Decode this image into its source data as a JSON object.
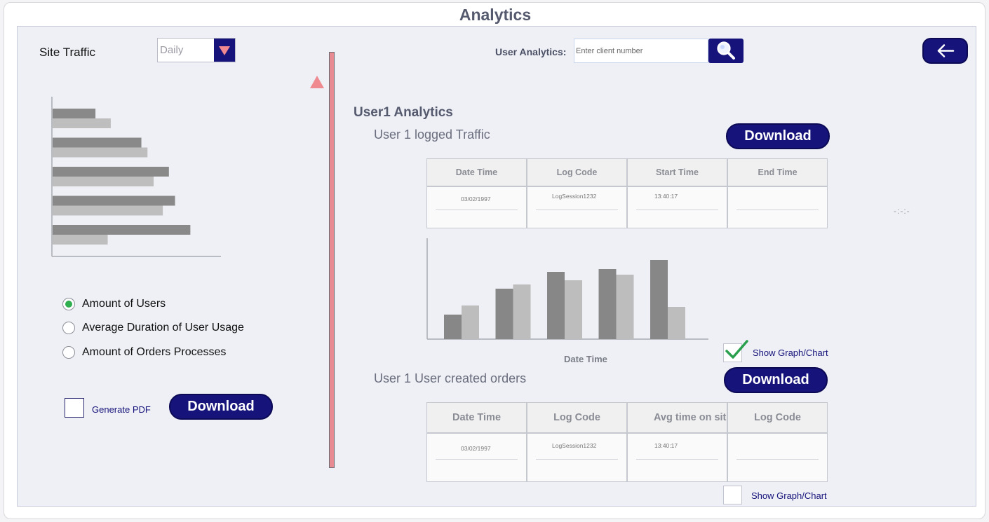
{
  "header": {
    "title": "Analytics"
  },
  "site_traffic": {
    "label": "Site Traffic",
    "period_dropdown": {
      "selected": "Daily"
    },
    "options": [
      {
        "label": "Amount of Users",
        "selected": true
      },
      {
        "label": "Average Duration of User Usage",
        "selected": false
      },
      {
        "label": "Amount of Orders Processes",
        "selected": false
      }
    ],
    "generate_pdf": {
      "label": "Generate PDF",
      "checked": false
    },
    "download_label": "Download"
  },
  "search": {
    "label": "User Analytics:",
    "placeholder": "Enter client number"
  },
  "user_panel": {
    "title": "User1 Analytics",
    "traffic": {
      "subtitle": "User 1 logged Traffic",
      "download_label": "Download",
      "table": {
        "headers": [
          "Date Time",
          "Log Code",
          "Start Time",
          "End Time"
        ],
        "rows": [
          [
            "03/02/1997",
            "LogSession1232",
            "13:40:17",
            ""
          ]
        ]
      },
      "chart_xlabel": "Date Time",
      "show_graph": {
        "label": "Show Graph/Chart",
        "checked": true
      }
    },
    "orders": {
      "subtitle": "User 1 User created orders",
      "download_label": "Download",
      "table": {
        "headers": [
          "Date Time",
          "Log Code",
          "Avg time on site",
          "Log Code"
        ],
        "rows": [
          [
            "03/02/1997",
            "LogSession1232",
            "13:40:17",
            ""
          ]
        ]
      },
      "show_graph": {
        "label": "Show Graph/Chart",
        "checked": false
      }
    },
    "time_placeholder": "-:-:-"
  },
  "chart_data": [
    {
      "type": "bar",
      "orientation": "horizontal",
      "series": [
        {
          "values": [
            14,
            29,
            38,
            40,
            45
          ]
        },
        {
          "values": [
            19,
            31,
            33,
            36,
            18
          ]
        }
      ],
      "xlim": [
        0,
        55
      ],
      "colors": [
        "#898989",
        "#bebebe"
      ]
    },
    {
      "type": "bar",
      "orientation": "vertical",
      "xlabel": "Date Time",
      "series": [
        {
          "values": [
            35,
            72,
            96,
            100,
            113
          ]
        },
        {
          "values": [
            48,
            78,
            84,
            92,
            46
          ]
        }
      ],
      "ylim": [
        0,
        145
      ],
      "colors": [
        "#878787",
        "#bdbdbd"
      ]
    }
  ]
}
